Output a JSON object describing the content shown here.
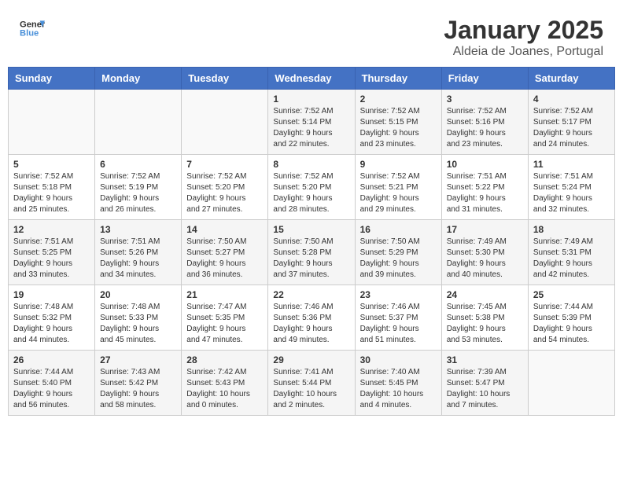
{
  "header": {
    "logo_general": "General",
    "logo_blue": "Blue",
    "month_title": "January 2025",
    "location": "Aldeia de Joanes, Portugal"
  },
  "days_of_week": [
    "Sunday",
    "Monday",
    "Tuesday",
    "Wednesday",
    "Thursday",
    "Friday",
    "Saturday"
  ],
  "weeks": [
    [
      {
        "day": "",
        "info": ""
      },
      {
        "day": "",
        "info": ""
      },
      {
        "day": "",
        "info": ""
      },
      {
        "day": "1",
        "info": "Sunrise: 7:52 AM\nSunset: 5:14 PM\nDaylight: 9 hours\nand 22 minutes."
      },
      {
        "day": "2",
        "info": "Sunrise: 7:52 AM\nSunset: 5:15 PM\nDaylight: 9 hours\nand 23 minutes."
      },
      {
        "day": "3",
        "info": "Sunrise: 7:52 AM\nSunset: 5:16 PM\nDaylight: 9 hours\nand 23 minutes."
      },
      {
        "day": "4",
        "info": "Sunrise: 7:52 AM\nSunset: 5:17 PM\nDaylight: 9 hours\nand 24 minutes."
      }
    ],
    [
      {
        "day": "5",
        "info": "Sunrise: 7:52 AM\nSunset: 5:18 PM\nDaylight: 9 hours\nand 25 minutes."
      },
      {
        "day": "6",
        "info": "Sunrise: 7:52 AM\nSunset: 5:19 PM\nDaylight: 9 hours\nand 26 minutes."
      },
      {
        "day": "7",
        "info": "Sunrise: 7:52 AM\nSunset: 5:20 PM\nDaylight: 9 hours\nand 27 minutes."
      },
      {
        "day": "8",
        "info": "Sunrise: 7:52 AM\nSunset: 5:20 PM\nDaylight: 9 hours\nand 28 minutes."
      },
      {
        "day": "9",
        "info": "Sunrise: 7:52 AM\nSunset: 5:21 PM\nDaylight: 9 hours\nand 29 minutes."
      },
      {
        "day": "10",
        "info": "Sunrise: 7:51 AM\nSunset: 5:22 PM\nDaylight: 9 hours\nand 31 minutes."
      },
      {
        "day": "11",
        "info": "Sunrise: 7:51 AM\nSunset: 5:24 PM\nDaylight: 9 hours\nand 32 minutes."
      }
    ],
    [
      {
        "day": "12",
        "info": "Sunrise: 7:51 AM\nSunset: 5:25 PM\nDaylight: 9 hours\nand 33 minutes."
      },
      {
        "day": "13",
        "info": "Sunrise: 7:51 AM\nSunset: 5:26 PM\nDaylight: 9 hours\nand 34 minutes."
      },
      {
        "day": "14",
        "info": "Sunrise: 7:50 AM\nSunset: 5:27 PM\nDaylight: 9 hours\nand 36 minutes."
      },
      {
        "day": "15",
        "info": "Sunrise: 7:50 AM\nSunset: 5:28 PM\nDaylight: 9 hours\nand 37 minutes."
      },
      {
        "day": "16",
        "info": "Sunrise: 7:50 AM\nSunset: 5:29 PM\nDaylight: 9 hours\nand 39 minutes."
      },
      {
        "day": "17",
        "info": "Sunrise: 7:49 AM\nSunset: 5:30 PM\nDaylight: 9 hours\nand 40 minutes."
      },
      {
        "day": "18",
        "info": "Sunrise: 7:49 AM\nSunset: 5:31 PM\nDaylight: 9 hours\nand 42 minutes."
      }
    ],
    [
      {
        "day": "19",
        "info": "Sunrise: 7:48 AM\nSunset: 5:32 PM\nDaylight: 9 hours\nand 44 minutes."
      },
      {
        "day": "20",
        "info": "Sunrise: 7:48 AM\nSunset: 5:33 PM\nDaylight: 9 hours\nand 45 minutes."
      },
      {
        "day": "21",
        "info": "Sunrise: 7:47 AM\nSunset: 5:35 PM\nDaylight: 9 hours\nand 47 minutes."
      },
      {
        "day": "22",
        "info": "Sunrise: 7:46 AM\nSunset: 5:36 PM\nDaylight: 9 hours\nand 49 minutes."
      },
      {
        "day": "23",
        "info": "Sunrise: 7:46 AM\nSunset: 5:37 PM\nDaylight: 9 hours\nand 51 minutes."
      },
      {
        "day": "24",
        "info": "Sunrise: 7:45 AM\nSunset: 5:38 PM\nDaylight: 9 hours\nand 53 minutes."
      },
      {
        "day": "25",
        "info": "Sunrise: 7:44 AM\nSunset: 5:39 PM\nDaylight: 9 hours\nand 54 minutes."
      }
    ],
    [
      {
        "day": "26",
        "info": "Sunrise: 7:44 AM\nSunset: 5:40 PM\nDaylight: 9 hours\nand 56 minutes."
      },
      {
        "day": "27",
        "info": "Sunrise: 7:43 AM\nSunset: 5:42 PM\nDaylight: 9 hours\nand 58 minutes."
      },
      {
        "day": "28",
        "info": "Sunrise: 7:42 AM\nSunset: 5:43 PM\nDaylight: 10 hours\nand 0 minutes."
      },
      {
        "day": "29",
        "info": "Sunrise: 7:41 AM\nSunset: 5:44 PM\nDaylight: 10 hours\nand 2 minutes."
      },
      {
        "day": "30",
        "info": "Sunrise: 7:40 AM\nSunset: 5:45 PM\nDaylight: 10 hours\nand 4 minutes."
      },
      {
        "day": "31",
        "info": "Sunrise: 7:39 AM\nSunset: 5:47 PM\nDaylight: 10 hours\nand 7 minutes."
      },
      {
        "day": "",
        "info": ""
      }
    ]
  ]
}
